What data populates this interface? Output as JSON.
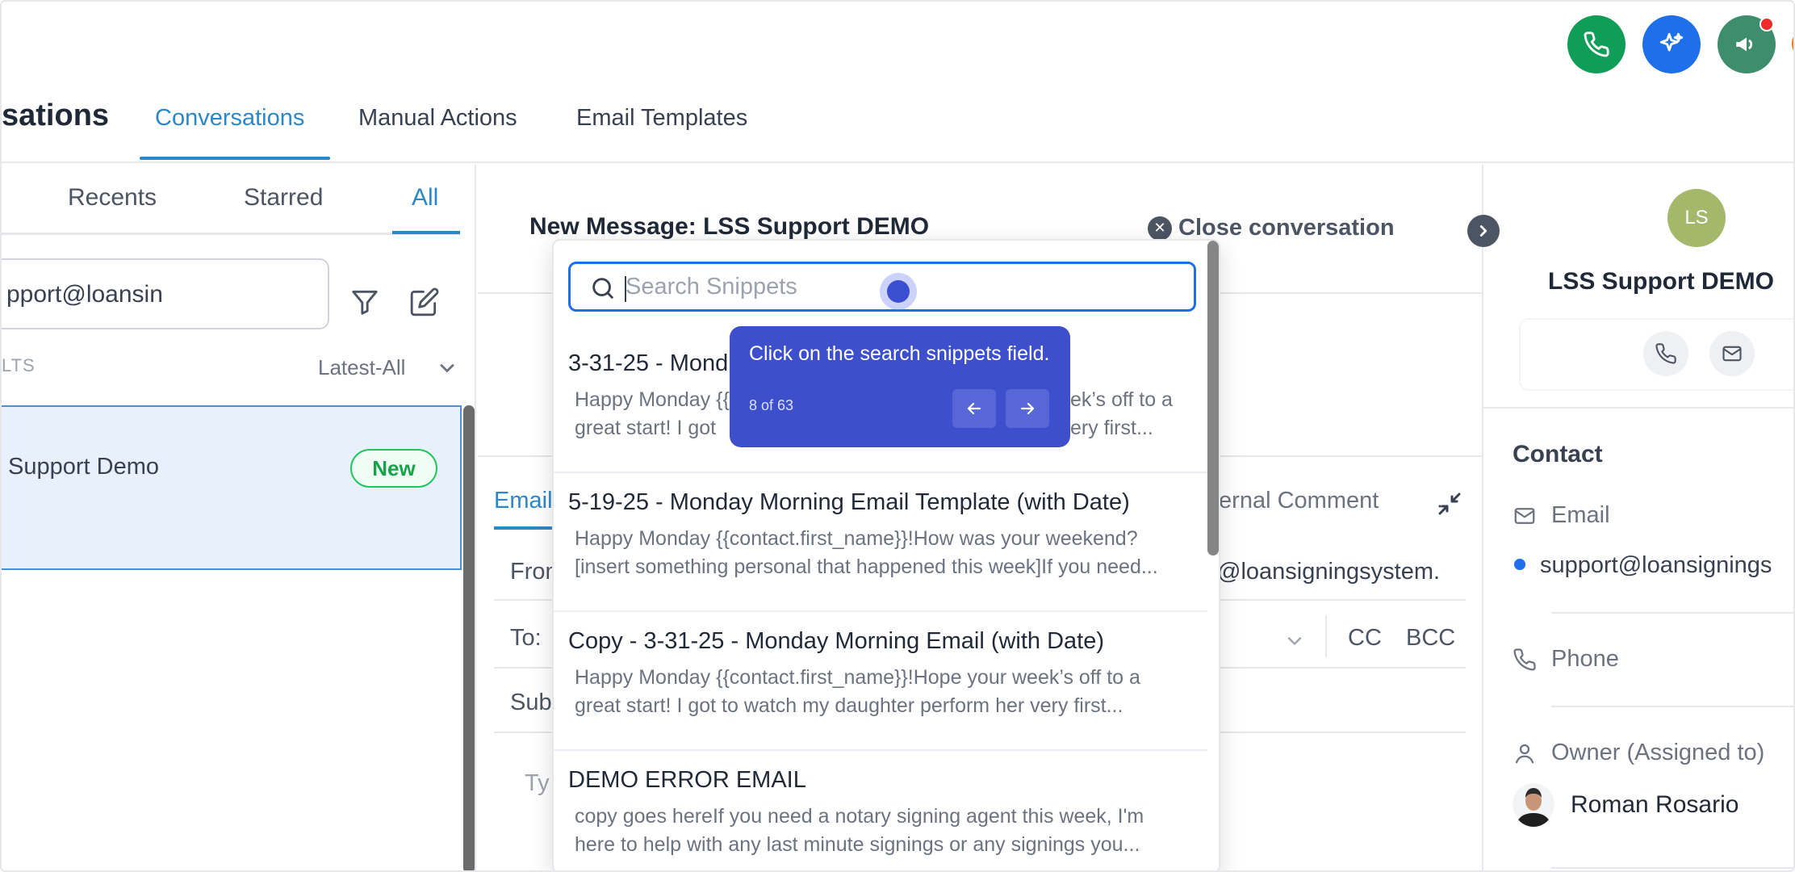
{
  "header": {
    "page_title": "sations",
    "tabs": [
      {
        "label": "Conversations",
        "active": true
      },
      {
        "label": "Manual Actions",
        "active": false
      },
      {
        "label": "Email Templates",
        "active": false
      }
    ]
  },
  "fab": {
    "phone_color": "#0f9d58",
    "ai_color": "#1f6feb",
    "announce_color": "#3e8e6e"
  },
  "left": {
    "tabs": [
      {
        "label": "Recents",
        "active": false
      },
      {
        "label": "Starred",
        "active": false
      },
      {
        "label": "All",
        "active": true
      }
    ],
    "search_value": "pport@loansin",
    "results_label": "LTS",
    "sort_label": "Latest-All",
    "conversation": {
      "name": "Support Demo",
      "badge": "New"
    }
  },
  "center": {
    "title": "New Message: LSS Support DEMO",
    "close_label": "Close conversation",
    "compose_tab": "Email",
    "internal_comment": "ternal Comment",
    "from_label": "From",
    "from_value": "@loansigningsystem.",
    "to_label": "To:",
    "cc": "CC",
    "bcc": "BCC",
    "subject_label": "Sub",
    "body_placeholder": "Ty"
  },
  "right": {
    "avatar_initials": "LS",
    "contact_name": "LSS Support DEMO",
    "section_title": "Contact",
    "email_label": "Email",
    "email_value": "support@loansignings",
    "phone_label": "Phone",
    "owner_label": "Owner (Assigned to)",
    "owner_name": "Roman Rosario"
  },
  "snippets": {
    "search_placeholder": "Search Snippets",
    "items": [
      {
        "title": "3-31-25 - Mond",
        "line1": "Happy Monday {{",
        "line2": "great start! I got",
        "tail1": "ek’s off to a",
        "tail2": "ery first..."
      },
      {
        "title": "5-19-25 - Monday Morning Email Template (with Date)",
        "line1": "Happy Monday {{contact.first_name}}!How was your weekend?",
        "line2": "[insert something personal that happened this week]If you need..."
      },
      {
        "title": "Copy - 3-31-25 - Monday Morning Email (with Date)",
        "line1": "Happy Monday {{contact.first_name}}!Hope your week’s off to a",
        "line2": "great start! I got to watch my daughter perform her very first..."
      },
      {
        "title": "DEMO ERROR EMAIL",
        "line1": "copy goes hereIf you need a notary signing agent this week, I'm",
        "line2": "here to help with any last minute signings or any signings you..."
      }
    ]
  },
  "tooltip": {
    "text": "Click on the search snippets field.",
    "counter": "8 of 63"
  }
}
